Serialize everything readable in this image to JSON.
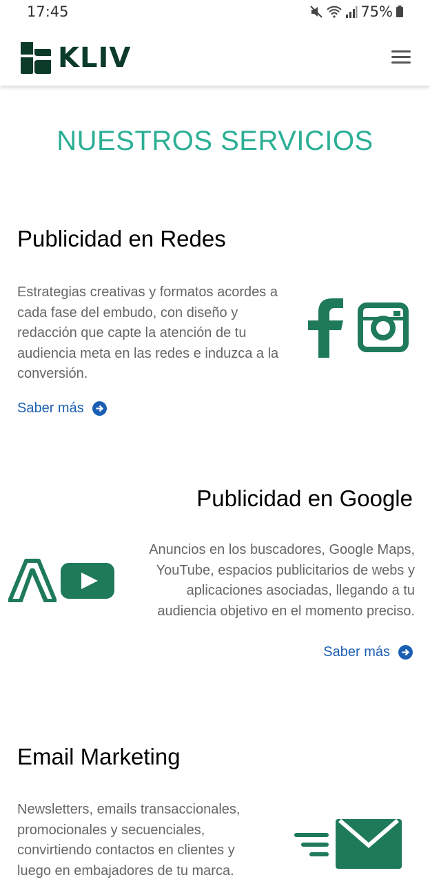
{
  "status_bar": {
    "time": "17:45",
    "battery": "75%"
  },
  "header": {
    "brand": "KLIV"
  },
  "section": {
    "title": "NUESTROS SERVICIOS"
  },
  "services": [
    {
      "title": "Publicidad en Redes",
      "description": "Estrategias creativas y formatos acordes a cada fase del embudo, con diseño y redacción que capte la atención de tu audiencia meta en las redes e induzca a la conversión.",
      "link": "Saber más"
    },
    {
      "title": "Publicidad en Google",
      "description": "Anuncios en los buscadores, Google Maps, YouTube, espacios publicitarios de webs y aplicaciones asociadas, llegando a tu audiencia objetivo en el momento preciso.",
      "link": "Saber más"
    },
    {
      "title": "Email Marketing",
      "description": "Newsletters, emails transaccionales, promocionales y secuenciales, convirtiendo contactos en clientes y luego en embajadores de tu marca."
    }
  ],
  "colors": {
    "accent": "#2baf94",
    "brand_green": "#1f7a5a",
    "logo_dark": "#0c3b2a",
    "link": "#1b5fb3"
  }
}
